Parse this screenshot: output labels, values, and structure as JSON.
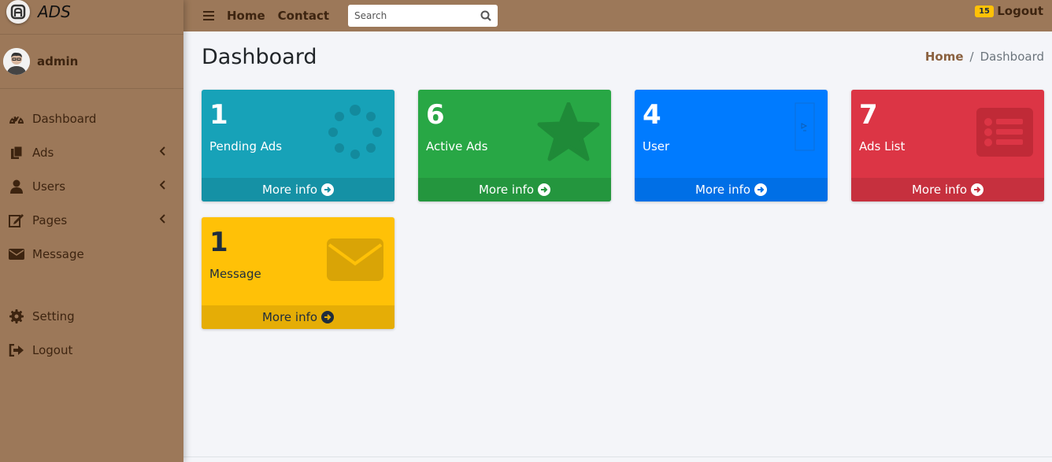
{
  "brand": {
    "name": "ADS"
  },
  "user": {
    "name": "admin"
  },
  "sidebar": {
    "items": [
      {
        "label": "Dashboard",
        "icon": "tachometer-icon"
      },
      {
        "label": "Ads",
        "icon": "copy-icon",
        "has_submenu": true
      },
      {
        "label": "Users",
        "icon": "user-icon",
        "has_submenu": true
      },
      {
        "label": "Pages",
        "icon": "edit-icon",
        "has_submenu": true
      },
      {
        "label": "Message",
        "icon": "envelope-icon"
      },
      {
        "label": "Setting",
        "icon": "gear-icon"
      },
      {
        "label": "Logout",
        "icon": "sign-out-icon"
      }
    ]
  },
  "topbar": {
    "home": "Home",
    "contact": "Contact",
    "search_placeholder": "Search",
    "notification_count": "15",
    "logout": "Logout"
  },
  "page": {
    "title": "Dashboard",
    "breadcrumb": {
      "home": "Home",
      "current": "Dashboard"
    }
  },
  "boxes": [
    {
      "count": "1",
      "title": "Pending Ads",
      "footer": "More info",
      "color": "#17a2b8",
      "icon": "spinner-icon"
    },
    {
      "count": "6",
      "title": "Active Ads",
      "footer": "More info",
      "color": "#28a745",
      "icon": "star-icon"
    },
    {
      "count": "4",
      "title": "User",
      "footer": "More info",
      "color": "#007bff",
      "icon": "broken-image-icon"
    },
    {
      "count": "7",
      "title": "Ads List",
      "footer": "More info",
      "color": "#dc3545",
      "icon": "list-icon"
    },
    {
      "count": "1",
      "title": "Message",
      "footer": "More info",
      "color": "#ffc107",
      "icon": "envelope-icon"
    }
  ],
  "colors": {
    "sidebar_bg": "#9c7859",
    "sidebar_text": "#3d2410",
    "content_bg": "#f4f5f9",
    "badge": "#ffc107"
  }
}
